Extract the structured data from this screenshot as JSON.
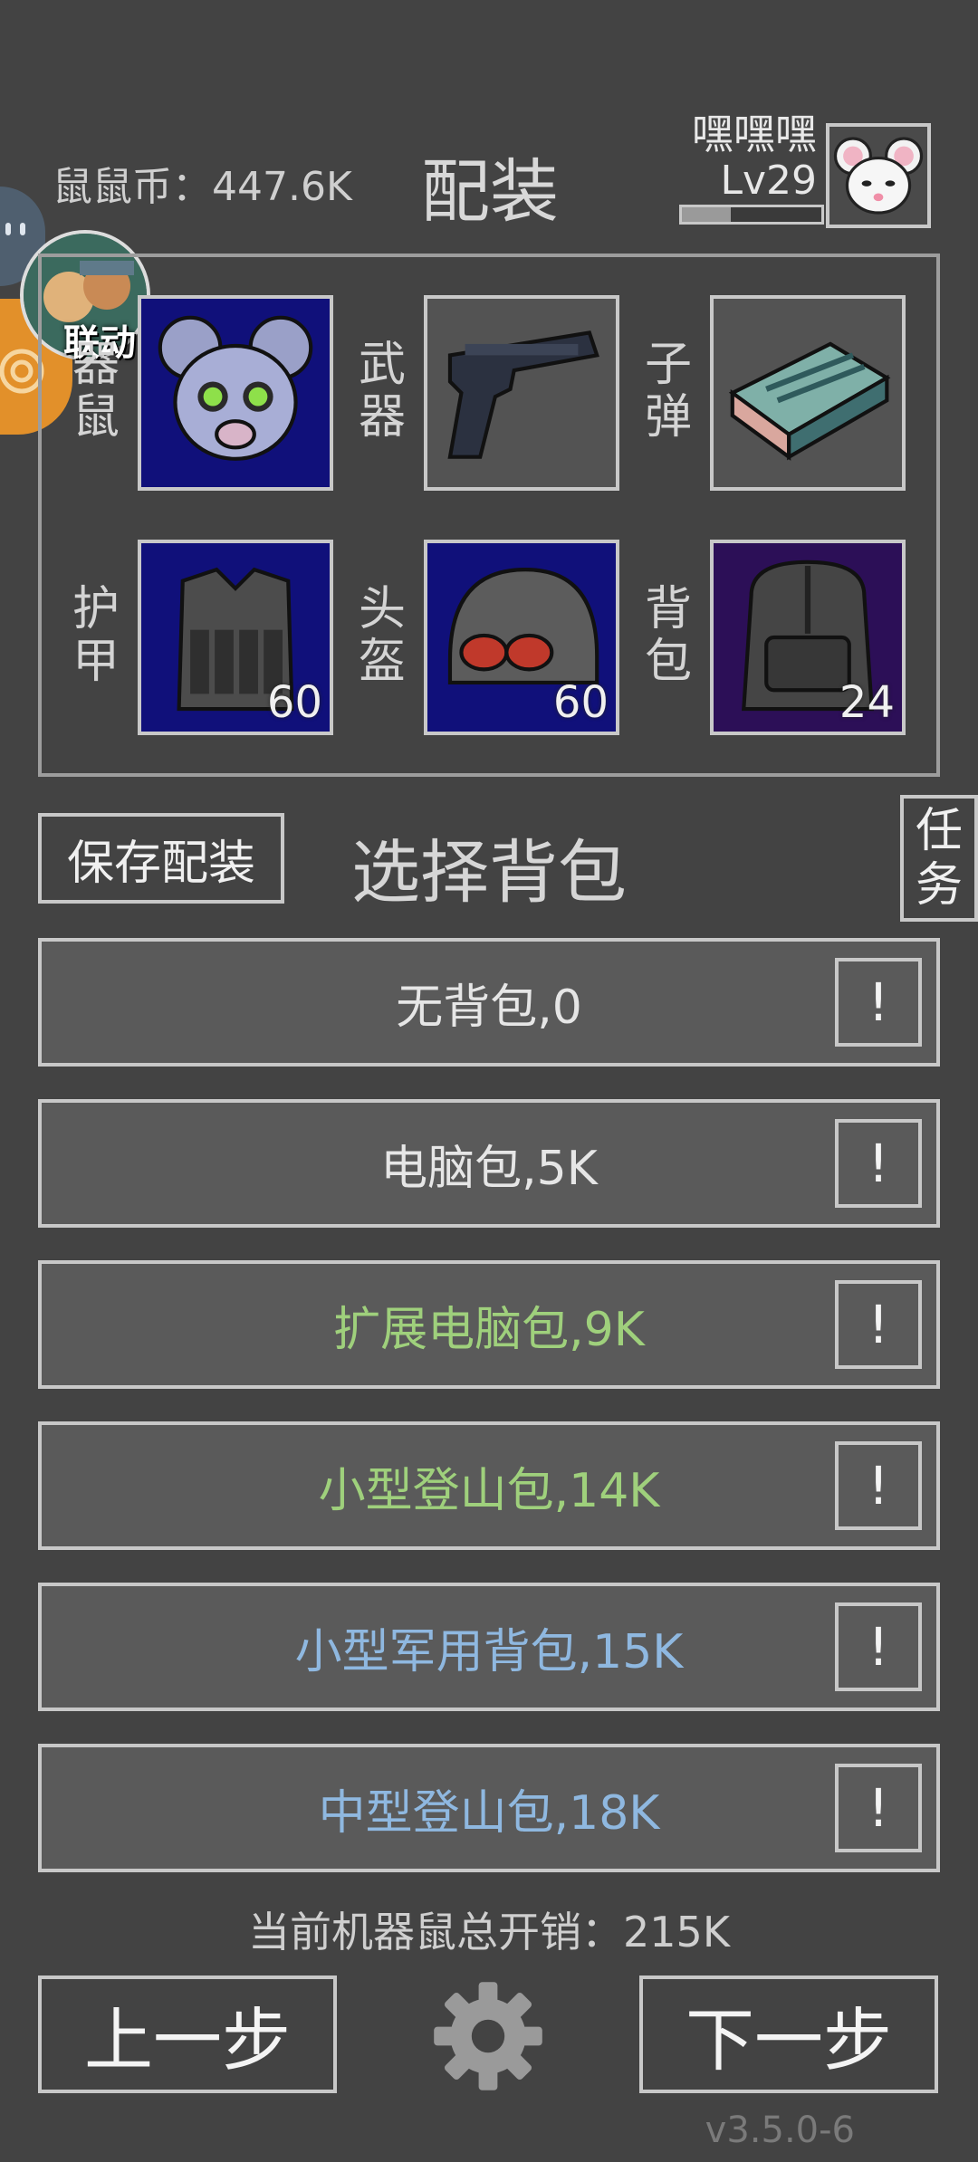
{
  "header": {
    "coins": "鼠鼠币：447.6K",
    "title": "配装",
    "player_name": "嘿嘿嘿",
    "player_level": "Lv29",
    "xp_fraction": 0.35
  },
  "side": {
    "collab_label": "联动"
  },
  "loadout": {
    "slots": [
      {
        "label": "器\n鼠",
        "count": ""
      },
      {
        "label": "武\n器",
        "count": ""
      },
      {
        "label": "子\n弹",
        "count": ""
      },
      {
        "label": "护\n甲",
        "count": "60"
      },
      {
        "label": "头\n盔",
        "count": "60"
      },
      {
        "label": "背\n包",
        "count": "24"
      }
    ]
  },
  "actions": {
    "save_label": "保存配装",
    "section_title": "选择背包",
    "task_label": "任\n务"
  },
  "backpacks": [
    {
      "name": "无背包,0",
      "info": "!",
      "color": "#e6e6e6"
    },
    {
      "name": "电脑包,5K",
      "info": "!",
      "color": "#e6e6e6"
    },
    {
      "name": "扩展电脑包,9K",
      "info": "!",
      "color": "#9fd07c"
    },
    {
      "name": "小型登山包,14K",
      "info": "!",
      "color": "#9fd07c"
    },
    {
      "name": "小型军用背包,15K",
      "info": "!",
      "color": "#8fb8e0"
    },
    {
      "name": "中型登山包,18K",
      "info": "!",
      "color": "#8fb8e0"
    }
  ],
  "footer": {
    "total_cost": "当前机器鼠总开销：215K",
    "prev_label": "上一步",
    "next_label": "下一步",
    "version": "v3.5.0-6"
  }
}
